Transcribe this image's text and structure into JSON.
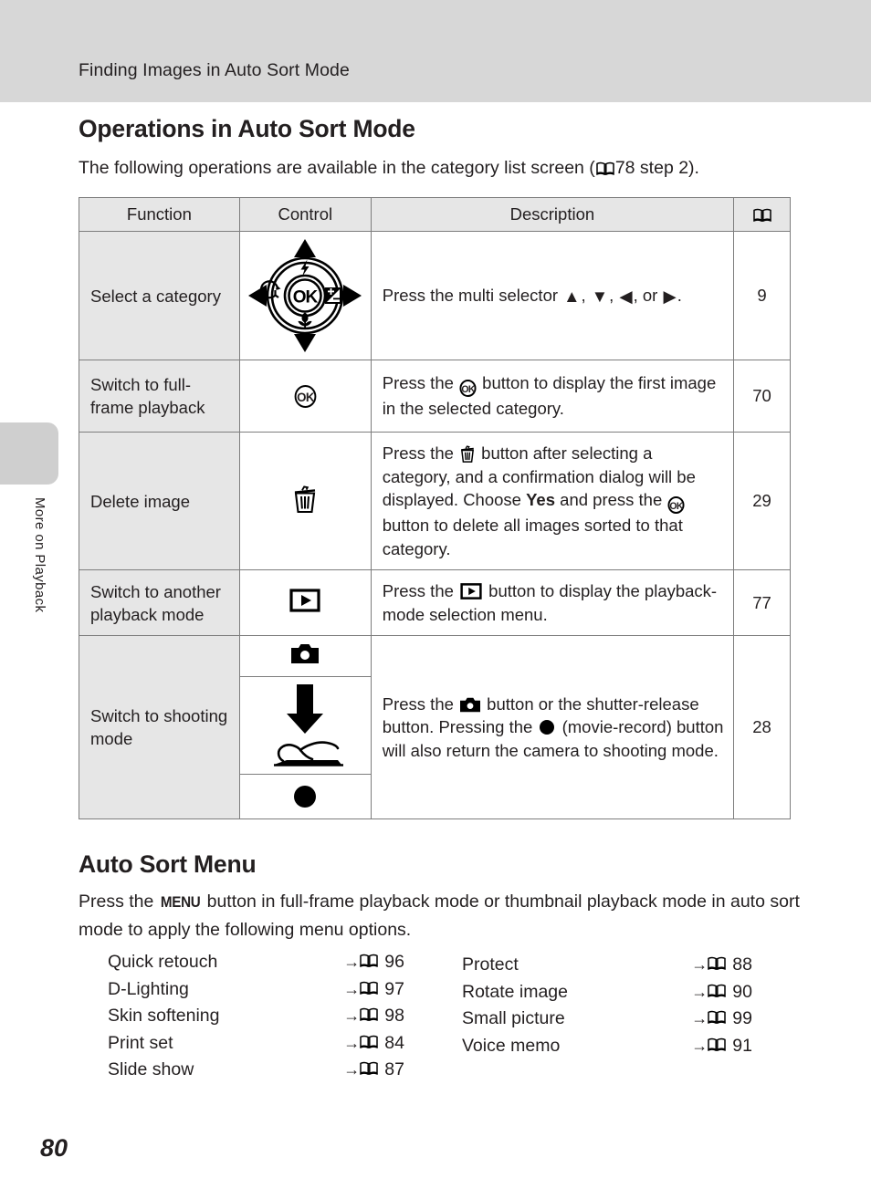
{
  "header": {
    "running_title": "Finding Images in Auto Sort Mode"
  },
  "side_tab": {
    "section_label": "More on Playback"
  },
  "page": {
    "number": "80"
  },
  "sections": {
    "operations": {
      "heading": "Operations in Auto Sort Mode",
      "lead_before": "The following operations are available in the category list screen (",
      "lead_ref_page": "78",
      "lead_after": " step 2)."
    },
    "menu": {
      "heading": "Auto Sort Menu",
      "lead_part1": "Press the ",
      "menu_glyph": "MENU",
      "lead_part2": " button in full-frame playback mode or thumbnail playback mode in auto sort mode to apply the following menu options."
    }
  },
  "table": {
    "headers": {
      "function": "Function",
      "control": "Control",
      "description": "Description",
      "reference": "book-icon"
    },
    "rows": [
      {
        "function": "Select a category",
        "control_icon": "multi-selector-dial",
        "control_labels": {
          "center": "OK",
          "top": "flash-icon",
          "left": "self-timer-icon",
          "right": "exposure-compensation-icon",
          "bottom": "macro-icon"
        },
        "description_part1": "Press the multi selector ",
        "description_arrows": "▲, ▼, ◀, or ▶",
        "description_part2": ".",
        "reference": "9"
      },
      {
        "function": "Switch to full-frame playback",
        "control_icon": "ok-button",
        "description_part1": "Press the ",
        "description_ok": "OK",
        "description_part2": " button to display the first image in the selected category.",
        "reference": "70"
      },
      {
        "function": "Delete image",
        "control_icon": "trash-button",
        "description_part1": "Press the ",
        "description_trash": "trash-icon",
        "description_part2": " button after selecting a category, and a confirmation dialog will be displayed. Choose ",
        "description_bold": "Yes",
        "description_part3": " and press the ",
        "description_ok": "OK",
        "description_part4": " button to delete all images sorted to that category.",
        "reference": "29"
      },
      {
        "function": "Switch to another playback mode",
        "control_icon": "playback-button",
        "description_part1": "Press the ",
        "description_play": "playback-icon",
        "description_part2": " button to display the playback-mode selection menu.",
        "reference": "77"
      },
      {
        "function": "Switch to shooting mode",
        "control_icons": [
          "camera-button",
          "shutter-release-button",
          "movie-record-button"
        ],
        "description_part1": "Press the ",
        "description_camera": "camera-icon",
        "description_part2": " button or the shutter-release button. Pressing the ",
        "description_record": "record-dot-icon",
        "description_part3": " (movie-record) button will also return the camera to shooting mode.",
        "reference": "28"
      }
    ]
  },
  "menu_options": {
    "left": [
      {
        "label": "Quick retouch",
        "page": "96"
      },
      {
        "label": "D-Lighting",
        "page": "97"
      },
      {
        "label": "Skin softening",
        "page": "98"
      },
      {
        "label": "Print set",
        "page": "84"
      },
      {
        "label": "Slide show",
        "page": "87"
      }
    ],
    "right": [
      {
        "label": "Protect",
        "page": "88"
      },
      {
        "label": "Rotate image",
        "page": "90"
      },
      {
        "label": "Small picture",
        "page": "99"
      },
      {
        "label": "Voice memo",
        "page": "91"
      }
    ]
  },
  "colors": {
    "header_band": "#d7d7d7",
    "table_header_bg": "#e6e6e6",
    "function_col_bg": "#e6e6e6",
    "border": "#7d7d7d",
    "text": "#231f20"
  }
}
